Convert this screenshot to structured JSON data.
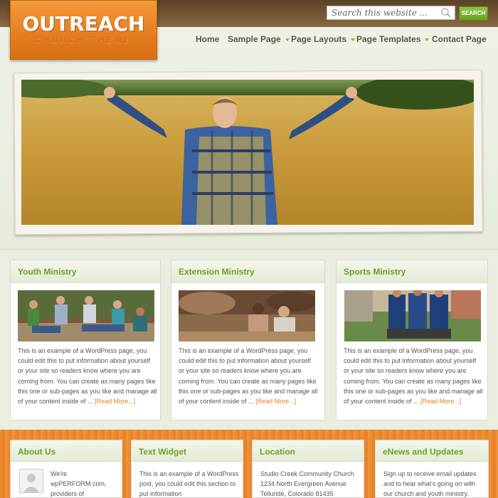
{
  "logo": {
    "title": "OUTREACH",
    "subtitle": "CHURCH THEME"
  },
  "search": {
    "placeholder": "Search this website ...",
    "button_label": "SEARCH"
  },
  "nav": {
    "items": [
      {
        "label": "Home"
      },
      {
        "label": "Sample Page"
      },
      {
        "label": "Page Layouts"
      },
      {
        "label": "Page Templates"
      },
      {
        "label": "Contact Page"
      }
    ]
  },
  "boxes": [
    {
      "title": "Youth Ministry",
      "text": "This is an example of a WordPress page, you could edit this to put information about yourself or your site so readers know where you are coming from. You can create as many pages like this one or sub-pages as you like and manage all of your content inside of ...",
      "read_more": "[Read More...]"
    },
    {
      "title": "Extension Ministry",
      "text": "This is an example of a WordPress page, you could edit this to put information about yourself or your site so readers know where you are coming from. You can create as many pages like this one or sub-pages as you like and manage all of your content inside of ...",
      "read_more": "[Read More...]"
    },
    {
      "title": "Sports Ministry",
      "text": "This is an example of a WordPress page, you could edit this to put information about yourself or your site so readers know where you are coming from. You can create as many pages like this one or sub-pages as you like and manage all of your content inside of ...",
      "read_more": "[Read More...]"
    }
  ],
  "widgets": {
    "about": {
      "title": "About Us",
      "text": "We're wpPERFORM.com, providers of"
    },
    "text_widget": {
      "title": "Text Widget",
      "text": "This is an example of a WordPress post, you could edit this section to put information"
    },
    "location": {
      "title": "Location",
      "line1": "Studio Creek Community Church",
      "line2": "1234 North Evergreen Avenue",
      "line3": "Telluride, Colorado 81435"
    },
    "enews": {
      "title": "eNews and Updates",
      "text": "Sign up to receive email updates and to hear what's going on with our church and youth ministry."
    }
  },
  "colors": {
    "accent_green": "#6aa124",
    "accent_orange": "#e57d1f",
    "header_brown": "#6b4f2e"
  },
  "icons": [
    "search-icon",
    "nav-dropdown-arrow-icon",
    "avatar-placeholder-icon"
  ]
}
